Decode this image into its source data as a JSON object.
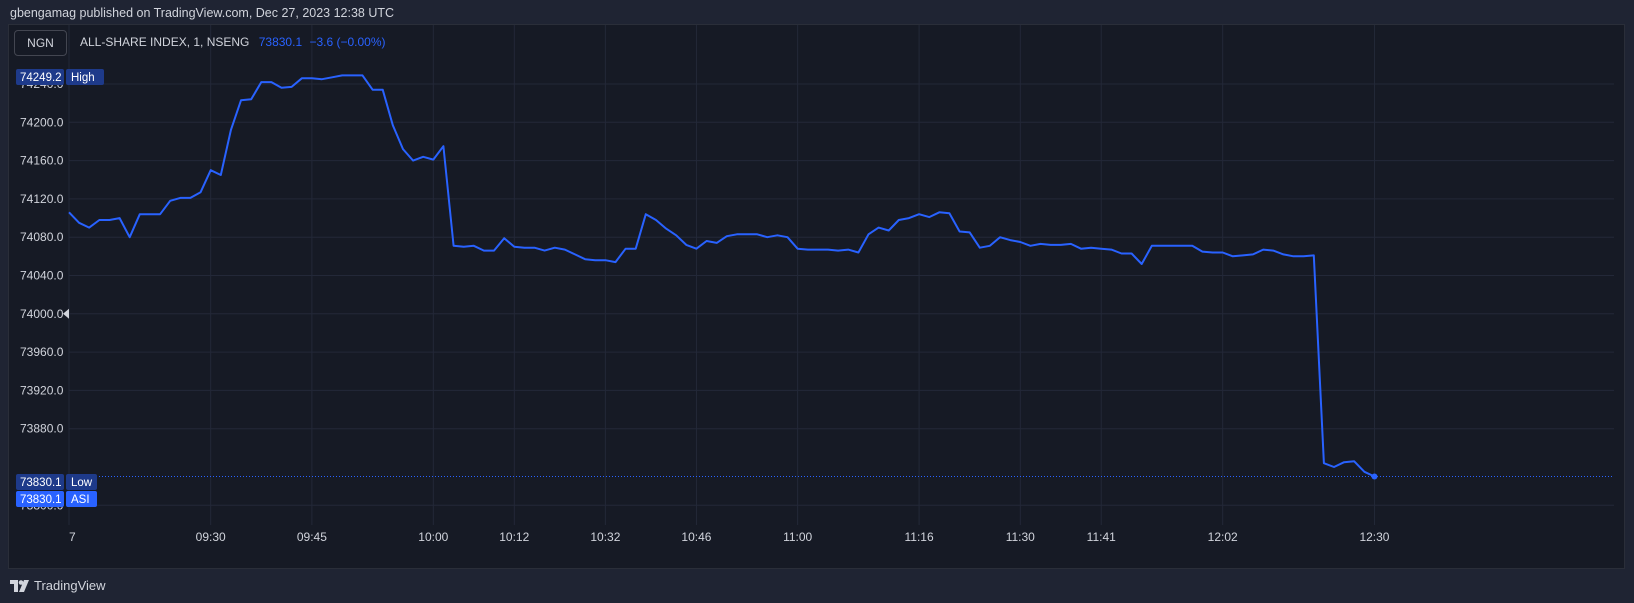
{
  "header": {
    "published_line": "gbengamag published on TradingView.com, Dec 27, 2023 12:38 UTC"
  },
  "toolbar": {
    "currency": "NGN"
  },
  "legend": {
    "symbol_line": "ALL-SHARE INDEX, 1, NSENG",
    "last_value": "73830.1",
    "change": "−3.6 (−0.00%)"
  },
  "markers": {
    "high_value": "74249.2",
    "high_label": "High",
    "low_value": "73830.1",
    "low_label": "Low",
    "last_value": "73830.1",
    "last_label": "ASI"
  },
  "footer": {
    "brand": "TradingView"
  },
  "colors": {
    "line": "#2962ff",
    "background": "#161a25",
    "grid": "#232838",
    "axis_text": "#d1d4dc",
    "marker_bg": "#1e3a8a",
    "last_marker_bg": "#2962ff"
  },
  "chart_data": {
    "type": "line",
    "title": "",
    "xlabel": "",
    "ylabel": "",
    "ylim": [
      73780,
      74255
    ],
    "y_ticks": [
      "74240.0",
      "74200.0",
      "74160.0",
      "74120.0",
      "74080.0",
      "74040.0",
      "74000.0",
      "73960.0",
      "73920.0",
      "73880.0",
      "73800.0"
    ],
    "x_ticks": [
      {
        "label": "7",
        "index": 0
      },
      {
        "label": "09:30",
        "index": 14
      },
      {
        "label": "09:45",
        "index": 24
      },
      {
        "label": "10:00",
        "index": 36
      },
      {
        "label": "10:12",
        "index": 44
      },
      {
        "label": "10:32",
        "index": 53
      },
      {
        "label": "10:46",
        "index": 62
      },
      {
        "label": "11:00",
        "index": 72
      },
      {
        "label": "11:16",
        "index": 84
      },
      {
        "label": "11:30",
        "index": 94
      },
      {
        "label": "11:41",
        "index": 102
      },
      {
        "label": "12:02",
        "index": 114
      },
      {
        "label": "12:30",
        "index": 129
      }
    ],
    "grid": true,
    "series": [
      {
        "values": [
          74106,
          74095,
          74090,
          74098,
          74098,
          74100,
          74080,
          74104,
          74104,
          74104,
          74118,
          74121,
          74121,
          74127,
          74150,
          74145,
          74192,
          74223,
          74224,
          74242,
          74242,
          74236,
          74237,
          74246,
          74246,
          74245,
          74247,
          74249,
          74249,
          74249,
          74234,
          74234,
          74197,
          74172,
          74160,
          74164,
          74161,
          74175,
          74071,
          74070,
          74071,
          74066,
          74066,
          74079,
          74070,
          74069,
          74069,
          74066,
          74069,
          74067,
          74062,
          74057,
          74056,
          74056,
          74054,
          74068,
          74068,
          74104,
          74098,
          74089,
          74082,
          74072,
          74068,
          74076,
          74074,
          74081,
          74083,
          74083,
          74083,
          74080,
          74082,
          74080,
          74068,
          74067,
          74067,
          74067,
          74066,
          74067,
          74064,
          74083,
          74090,
          74087,
          74098,
          74100,
          74104,
          74101,
          74106,
          74105,
          74086,
          74085,
          74069,
          74071,
          74080,
          74077,
          74075,
          74071,
          74073,
          74072,
          74072,
          74073,
          74068,
          74069,
          74068,
          74067,
          74063,
          74063,
          74052,
          74071,
          74071,
          74071,
          74071,
          74071,
          74065,
          74064,
          74064,
          74060,
          74061,
          74062,
          74067,
          74066,
          74062,
          74060,
          74060,
          74061,
          73844,
          73840,
          73845,
          73846,
          73835,
          73830.1
        ]
      }
    ]
  }
}
